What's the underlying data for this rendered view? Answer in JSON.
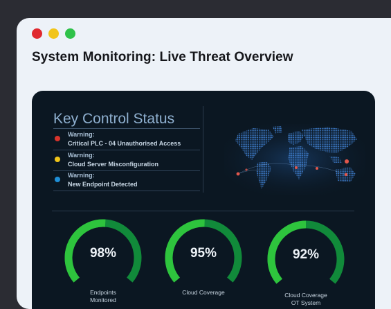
{
  "window": {
    "controls": [
      {
        "name": "close",
        "color": "#e0292f"
      },
      {
        "name": "minimize",
        "color": "#f2c51a"
      },
      {
        "name": "maximize",
        "color": "#2fc24a"
      }
    ],
    "title": "System Monitoring: Live Threat Overview"
  },
  "key_control": {
    "title": "Key Control Status",
    "warnings": [
      {
        "label": "Warning:",
        "message": "Critical PLC - 04 Unauthorised Access",
        "color": "#d8342c"
      },
      {
        "label": "Warning:",
        "message": "Cloud Server Misconfiguration",
        "color": "#f0c419"
      },
      {
        "label": "Warning:",
        "message": "New Endpoint Detected",
        "color": "#1f8fd6"
      }
    ]
  },
  "map": {
    "icon": "world-map-icon"
  },
  "gauges": [
    {
      "value": 98,
      "display": "98%",
      "label_line1": "Endpoints",
      "label_line2": "Monitored"
    },
    {
      "value": 95,
      "display": "95%",
      "label_line1": "Cloud Coverage",
      "label_line2": ""
    },
    {
      "value": 92,
      "display": "92%",
      "label_line1": "Cloud Coverage",
      "label_line2": "OT System"
    }
  ],
  "colors": {
    "gauge_light": "#2ec43d",
    "gauge_dark": "#118a3a"
  }
}
